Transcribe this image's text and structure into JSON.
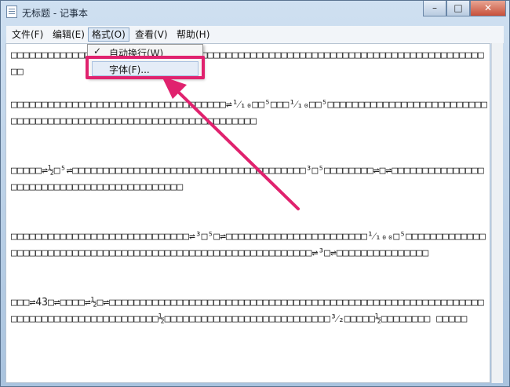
{
  "window": {
    "title": "无标题 - 记事本",
    "controls": [
      "–",
      "□",
      "✕"
    ]
  },
  "menu": [
    {
      "label": "文件(F)"
    },
    {
      "label": "编辑(E)"
    },
    {
      "label": "格式(O)"
    },
    {
      "label": "查看(V)"
    },
    {
      "label": "帮助(H)"
    }
  ],
  "format_menu": {
    "check": "✓",
    "word_wrap": "自动换行(W)",
    "font": "字体(F)..."
  },
  "editor": {
    "paragraphs": [
      "□□□□□□□□□□□□□□□□□□□□□□□□□□□□□□□□□□□□□□□□□□□□□□□□□□□□□□□□□□□□□□□□□□□□□□□□□□□□□□□",
      "□□□□□□□□□□□□□□□□□□□□□□□□□□□□□□□□□□□⇌¹⁄₁₀□□⁵□□□¹⁄₁₀□□⁵□□□□□□□□□□□□□□□□□□□□□□□□□□□□□□□□□□□□□□□□□□□□□□□□□□□□□□□□□□□□□□□□□□",
      "□□□□□⇌½□⁵⇌□□□□□□□□□□□□□□□□□□□□□□□□□□□□□□□□□□□□□□³□⁵□□□□□□□□⇌□⇌□□□□□□□□□□□□□□□□□□□□□□□□□□□□□□□□□□□□□□□□□□□",
      "□□□□□□□□□□□□□□□□□□□□□□□□□□□□□⇌³□⁵□⇌□□□□□□□□□□□□□□□□□□□□□□□¹⁄₁₀₀□⁵□□□□□□□□□□□□□□□□□□□□□□□□□□□□□□□□□□□□□□□□□□□□□□□□□□□□□□□□□□□□□□⇌³□⇌□□□□□□□□□□□□□□□",
      "□□□⇌43□⇌□□□□⇌½□⇌□□□□□□□□□□□□□□□□□□□□□□□□□□□□□□□□□□□□□□□□□□□□□□□□□□□□□□□□□□□□□□□□□□□□□□□□□□□□□□□□□□□□□½□□□□□□□□□□□□□□□□□□□□□□□□□□□³⁄₂□□□□□½□□□□□□□□ □□□□□"
    ]
  }
}
